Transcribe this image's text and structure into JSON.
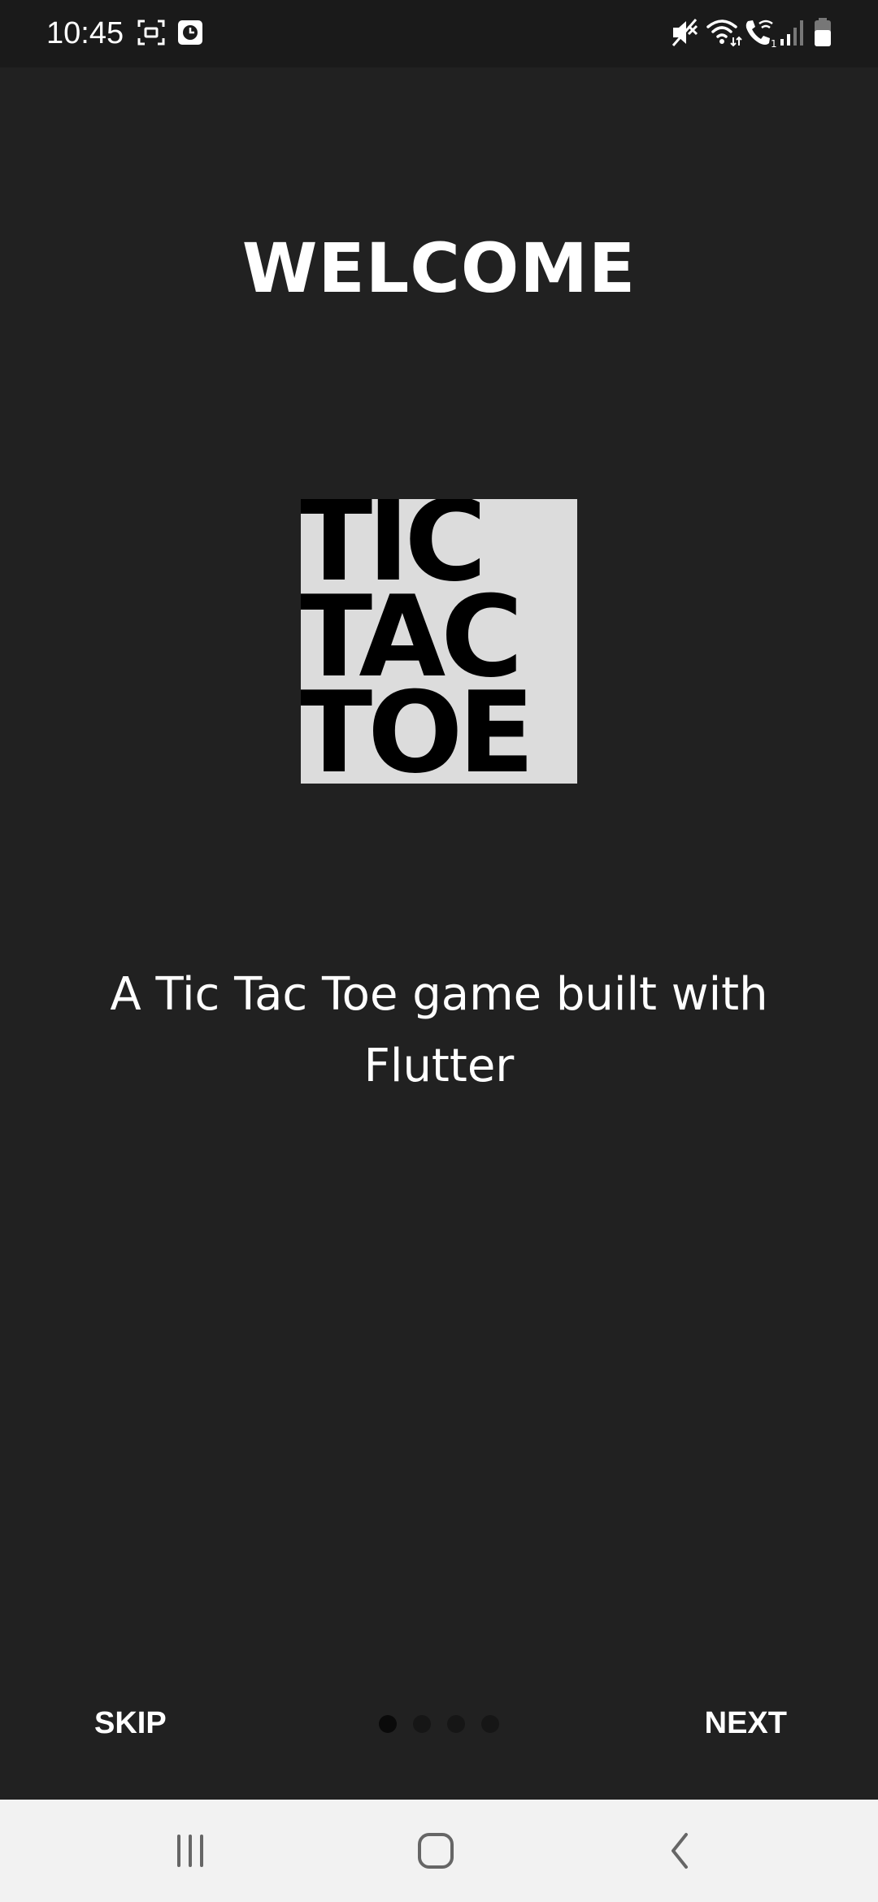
{
  "status_bar": {
    "time": "10:45",
    "left_icons": [
      "screenshot-icon",
      "clock-app-icon"
    ],
    "right_icons": [
      "mute-icon",
      "wifi-icon",
      "wifi-call-icon",
      "signal-icon",
      "battery-icon"
    ]
  },
  "onboarding": {
    "title": "WELCOME",
    "logo_lines": [
      "TIC",
      "TAC",
      "TOE"
    ],
    "description": "A Tic Tac Toe game built with Flutter",
    "skip_label": "SKIP",
    "next_label": "NEXT",
    "page_count": 4,
    "active_page": 1
  },
  "nav_bar": {
    "buttons": [
      "recent-apps-icon",
      "home-icon",
      "back-icon"
    ]
  },
  "colors": {
    "background": "#212121",
    "status_bar": "#1a1a1a",
    "nav_bar": "#f2f2f2",
    "logo_background": "#dcdcdc",
    "text": "#ffffff"
  }
}
